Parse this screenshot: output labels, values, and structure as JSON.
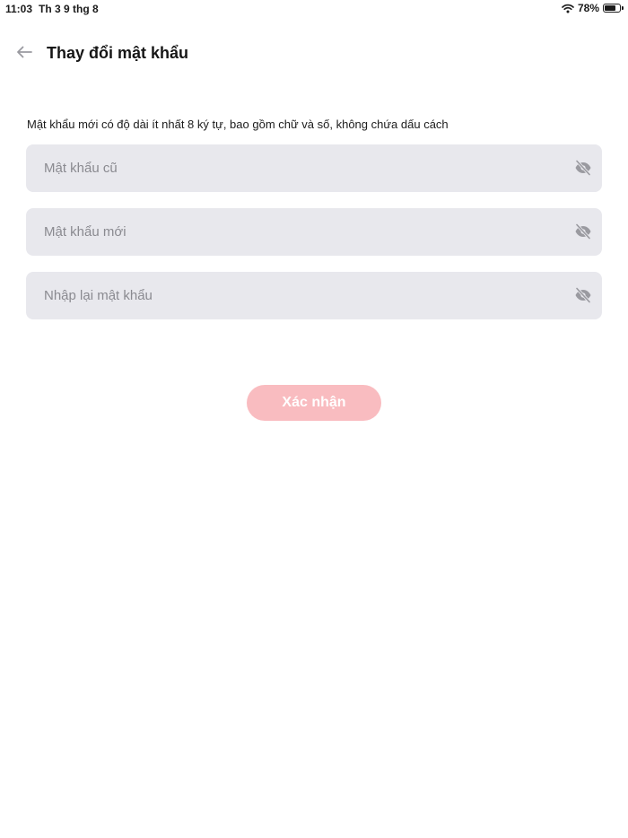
{
  "status_bar": {
    "time": "11:03",
    "date": "Th 3 9 thg 8",
    "battery": "78%",
    "battery_level": 0.78,
    "wifi_icon": "wifi-icon",
    "battery_icon": "battery-icon"
  },
  "header": {
    "back_icon": "arrow-left-icon",
    "title": "Thay đổi mật khẩu"
  },
  "form": {
    "hint": "Mật khẩu mới có độ dài ít nhất 8 ký tự, bao gồm chữ và số, không chứa dấu cách",
    "fields": [
      {
        "placeholder": "Mật khẩu cũ",
        "value": "",
        "toggle_icon": "eye-off-icon"
      },
      {
        "placeholder": "Mật khẩu mới",
        "value": "",
        "toggle_icon": "eye-off-icon"
      },
      {
        "placeholder": "Nhập lại mật khẩu",
        "value": "",
        "toggle_icon": "eye-off-icon"
      }
    ],
    "submit_label": "Xác nhận"
  },
  "colors": {
    "field_background": "#e8e8ed",
    "placeholder": "#8a8a90",
    "submit_button_disabled": "#f9bcc0",
    "icon_gray": "#9a9aa0",
    "text_primary": "#161616"
  }
}
